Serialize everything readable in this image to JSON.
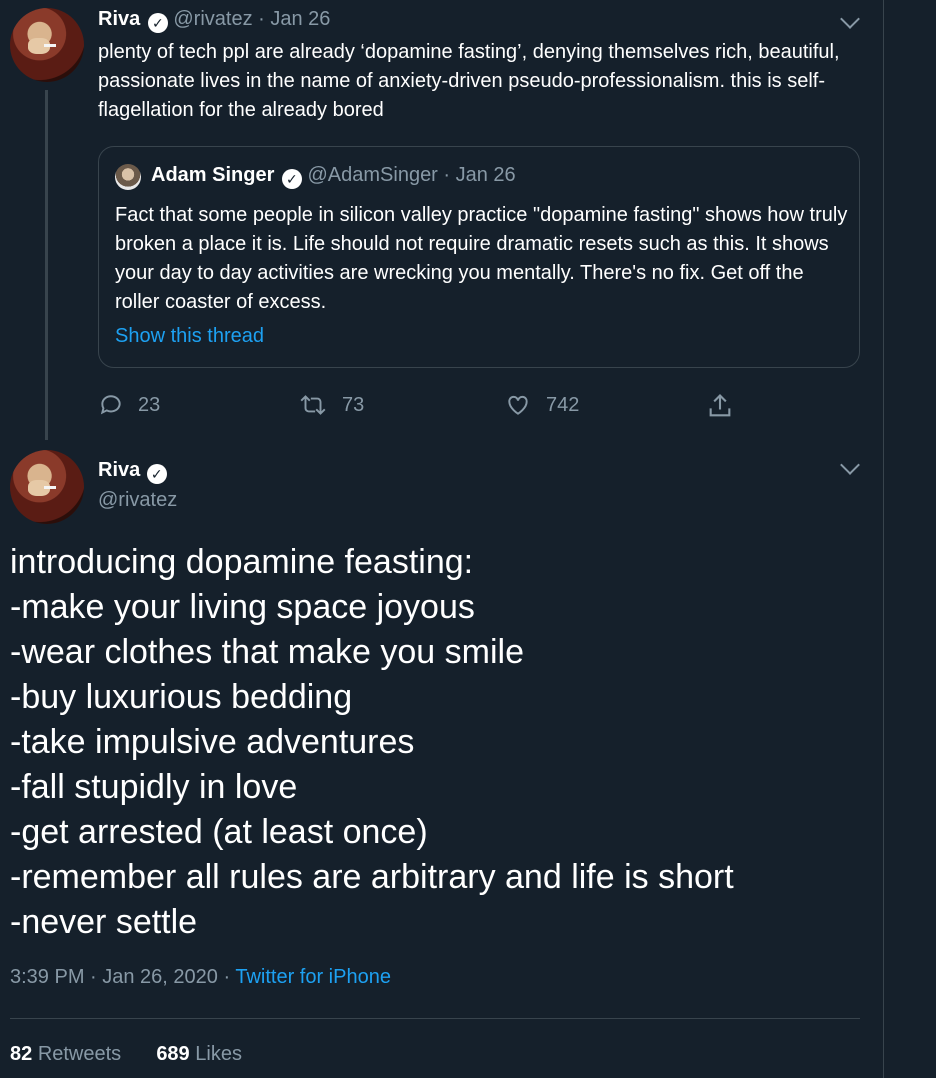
{
  "first_tweet": {
    "name": "Riva",
    "handle_date": "@rivatez · Jan 26",
    "body": "plenty of tech ppl are already ‘dopamine fasting’, denying themselves rich, beautiful, passionate lives in the name of anxiety-driven pseudo-professionalism. this is self-flagellation for the already bored",
    "quote": {
      "name": "Adam Singer",
      "handle_date": "@AdamSinger · Jan 26",
      "body": "Fact that some people in silicon valley practice \"dopamine fasting\" shows how truly broken a place it is. Life should not require dramatic resets such as this. It shows your day to day activities are wrecking you mentally. There's no fix. Get off the roller coaster of excess.",
      "show_thread": "Show this thread"
    },
    "actions": {
      "replies": "23",
      "retweets": "73",
      "likes": "742"
    }
  },
  "main_tweet": {
    "name": "Riva",
    "handle": "@rivatez",
    "lines": [
      "introducing dopamine feasting:",
      "-make your living space joyous",
      "-wear clothes that make you smile",
      "-buy luxurious bedding",
      "-take impulsive adventures",
      "-fall stupidly in love",
      "-get arrested (at least once)",
      "-remember all rules are arbitrary and life is short",
      "-never settle"
    ],
    "timestamp": "3:39 PM · Jan 26, 2020 · ",
    "source": "Twitter for iPhone",
    "retweets_count": "82",
    "retweets_label": "Retweets",
    "likes_count": "689",
    "likes_label": "Likes"
  },
  "colors": {
    "background": "#15202b",
    "accent": "#1da1f2",
    "muted": "#8899a6",
    "border": "#38444d"
  },
  "icons": [
    "reply-icon",
    "retweet-icon",
    "like-icon",
    "share-icon",
    "verified-icon",
    "chevron-down-icon"
  ]
}
